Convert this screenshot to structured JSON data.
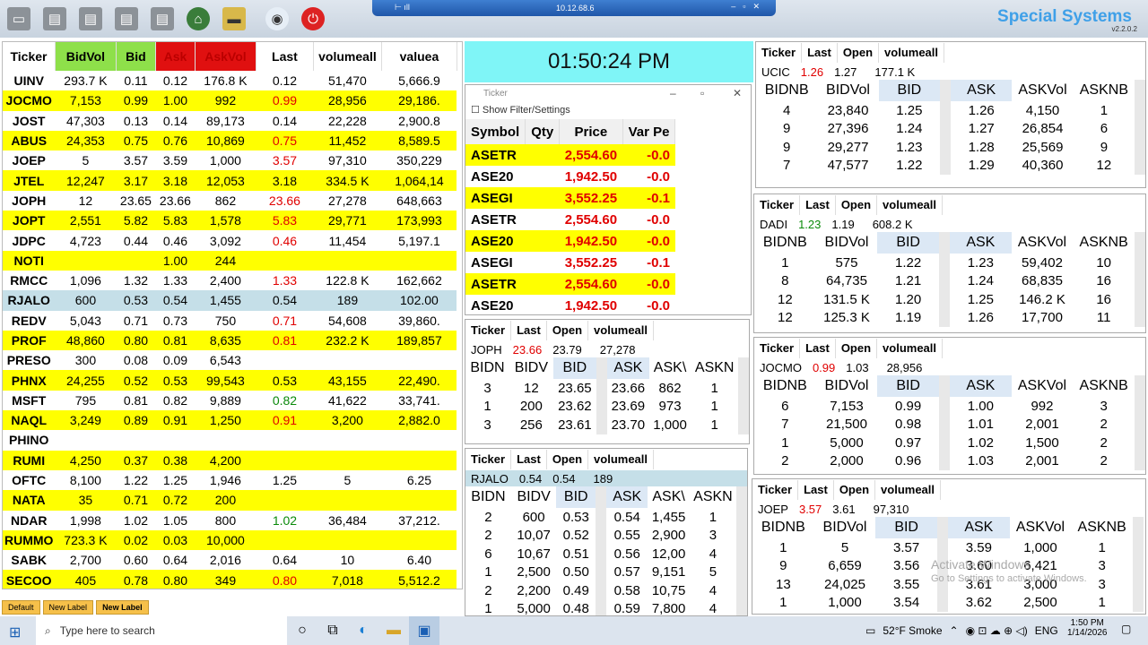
{
  "remote": {
    "host": "10.12.68.6"
  },
  "brand": {
    "name": "Special Systems",
    "version": "v2.2.0.2"
  },
  "clock": "01:50:24 PM",
  "main_table": {
    "headers": [
      "Ticker",
      "BidVol",
      "Bid",
      "Ask",
      "AskVol",
      "Last",
      "volumeall",
      "valuea"
    ],
    "rows": [
      {
        "style": "wr",
        "c": [
          "UINV",
          "293.7 K",
          "0.11",
          "0.12",
          "176.8 K",
          "0.12",
          "51,470",
          "5,666.9"
        ],
        "last": ""
      },
      {
        "style": "yr",
        "c": [
          "JOCMO",
          "7,153",
          "0.99",
          "1.00",
          "992",
          "0.99",
          "28,956",
          "29,186."
        ],
        "last": "red"
      },
      {
        "style": "wr",
        "c": [
          "JOST",
          "47,303",
          "0.13",
          "0.14",
          "89,173",
          "0.14",
          "22,228",
          "2,900.8"
        ],
        "last": ""
      },
      {
        "style": "yr",
        "c": [
          "ABUS",
          "24,353",
          "0.75",
          "0.76",
          "10,869",
          "0.75",
          "11,452",
          "8,589.5"
        ],
        "last": "red"
      },
      {
        "style": "wr",
        "c": [
          "JOEP",
          "5",
          "3.57",
          "3.59",
          "1,000",
          "3.57",
          "97,310",
          "350,229"
        ],
        "last": "red"
      },
      {
        "style": "yr",
        "c": [
          "JTEL",
          "12,247",
          "3.17",
          "3.18",
          "12,053",
          "3.18",
          "334.5 K",
          "1,064,14"
        ],
        "last": ""
      },
      {
        "style": "wr",
        "c": [
          "JOPH",
          "12",
          "23.65",
          "23.66",
          "862",
          "23.66",
          "27,278",
          "648,663"
        ],
        "last": "red"
      },
      {
        "style": "yr",
        "c": [
          "JOPT",
          "2,551",
          "5.82",
          "5.83",
          "1,578",
          "5.83",
          "29,771",
          "173,993"
        ],
        "last": "red"
      },
      {
        "style": "wr",
        "c": [
          "JDPC",
          "4,723",
          "0.44",
          "0.46",
          "3,092",
          "0.46",
          "11,454",
          "5,197.1"
        ],
        "last": "red"
      },
      {
        "style": "yr",
        "c": [
          "NOTI",
          "",
          "",
          "1.00",
          "244",
          "",
          "",
          ""
        ],
        "last": ""
      },
      {
        "style": "wr",
        "c": [
          "RMCC",
          "1,096",
          "1.32",
          "1.33",
          "2,400",
          "1.33",
          "122.8 K",
          "162,662"
        ],
        "last": "red"
      },
      {
        "style": "br",
        "c": [
          "RJALO",
          "600",
          "0.53",
          "0.54",
          "1,455",
          "0.54",
          "189",
          "102.00"
        ],
        "last": ""
      },
      {
        "style": "wr",
        "c": [
          "REDV",
          "5,043",
          "0.71",
          "0.73",
          "750",
          "0.71",
          "54,608",
          "39,860."
        ],
        "last": "red"
      },
      {
        "style": "yr",
        "c": [
          "PROF",
          "48,860",
          "0.80",
          "0.81",
          "8,635",
          "0.81",
          "232.2 K",
          "189,857"
        ],
        "last": "red"
      },
      {
        "style": "wr",
        "c": [
          "PRESO",
          "300",
          "0.08",
          "0.09",
          "6,543",
          "",
          "",
          ""
        ],
        "last": ""
      },
      {
        "style": "yr",
        "c": [
          "PHNX",
          "24,255",
          "0.52",
          "0.53",
          "99,543",
          "0.53",
          "43,155",
          "22,490."
        ],
        "last": ""
      },
      {
        "style": "wr",
        "c": [
          "MSFT",
          "795",
          "0.81",
          "0.82",
          "9,889",
          "0.82",
          "41,622",
          "33,741."
        ],
        "last": "grn"
      },
      {
        "style": "yr",
        "c": [
          "NAQL",
          "3,249",
          "0.89",
          "0.91",
          "1,250",
          "0.91",
          "3,200",
          "2,882.0"
        ],
        "last": "red"
      },
      {
        "style": "wr",
        "c": [
          "PHINO",
          "",
          "",
          "",
          "",
          "",
          "",
          ""
        ],
        "last": ""
      },
      {
        "style": "yr",
        "c": [
          "RUMI",
          "4,250",
          "0.37",
          "0.38",
          "4,200",
          "",
          "",
          ""
        ],
        "last": ""
      },
      {
        "style": "wr",
        "c": [
          "OFTC",
          "8,100",
          "1.22",
          "1.25",
          "1,946",
          "1.25",
          "5",
          "6.25"
        ],
        "last": ""
      },
      {
        "style": "yr",
        "c": [
          "NATA",
          "35",
          "0.71",
          "0.72",
          "200",
          "",
          "",
          ""
        ],
        "last": ""
      },
      {
        "style": "wr",
        "c": [
          "NDAR",
          "1,998",
          "1.02",
          "1.05",
          "800",
          "1.02",
          "36,484",
          "37,212."
        ],
        "last": "grn"
      },
      {
        "style": "yr",
        "c": [
          "RUMMO",
          "723.3 K",
          "0.02",
          "0.03",
          "10,000",
          "",
          "",
          ""
        ],
        "last": ""
      },
      {
        "style": "wr",
        "c": [
          "SABK",
          "2,700",
          "0.60",
          "0.64",
          "2,016",
          "0.64",
          "10",
          "6.40"
        ],
        "last": ""
      },
      {
        "style": "yr",
        "c": [
          "SECOO",
          "405",
          "0.78",
          "0.80",
          "349",
          "0.80",
          "7,018",
          "5,512.2"
        ],
        "last": "red"
      }
    ]
  },
  "labels": [
    "Default",
    "New Label",
    "New Label"
  ],
  "ticker_window": {
    "title": "Ticker",
    "filter_label": "Show Filter/Settings",
    "headers": [
      "Symbol",
      "Qty",
      "Price",
      "Var Pe"
    ],
    "rows": [
      {
        "style": "yr",
        "c": [
          "ASETR",
          "",
          "2,554.60",
          "-0.0"
        ]
      },
      {
        "style": "wr",
        "c": [
          "ASE20",
          "",
          "1,942.50",
          "-0.0"
        ]
      },
      {
        "style": "yr",
        "c": [
          "ASEGI",
          "",
          "3,552.25",
          "-0.1"
        ]
      },
      {
        "style": "wr",
        "c": [
          "ASETR",
          "",
          "2,554.60",
          "-0.0"
        ]
      },
      {
        "style": "yr",
        "c": [
          "ASE20",
          "",
          "1,942.50",
          "-0.0"
        ]
      },
      {
        "style": "wr",
        "c": [
          "ASEGI",
          "",
          "3,552.25",
          "-0.1"
        ]
      },
      {
        "style": "yr",
        "c": [
          "ASETR",
          "",
          "2,554.60",
          "-0.0"
        ]
      },
      {
        "style": "wr",
        "c": [
          "ASE20",
          "",
          "1,942.50",
          "-0.0"
        ]
      }
    ]
  },
  "quote_head": [
    "Ticker",
    "Last",
    "Open",
    "volumeall"
  ],
  "depth_head_left": [
    "BIDNB",
    "BIDVol",
    "BID"
  ],
  "depth_head_right": [
    "ASK",
    "ASKVol",
    "ASKNB"
  ],
  "depth_head_left_s": [
    "BIDN",
    "BIDV",
    "BID"
  ],
  "depth_head_right_s": [
    "ASK",
    "ASK\\",
    "ASKN"
  ],
  "books": [
    {
      "ticker": "UCIC",
      "last": "1.26",
      "open": "1.27",
      "vol": "177.1 K",
      "last_color": "red",
      "bids": [
        [
          "4",
          "23,840",
          "1.25"
        ],
        [
          "9",
          "27,396",
          "1.24"
        ],
        [
          "9",
          "29,277",
          "1.23"
        ],
        [
          "7",
          "47,577",
          "1.22"
        ]
      ],
      "asks": [
        [
          "1.26",
          "4,150",
          "1"
        ],
        [
          "1.27",
          "26,854",
          "6"
        ],
        [
          "1.28",
          "25,569",
          "9"
        ],
        [
          "1.29",
          "40,360",
          "12"
        ]
      ]
    },
    {
      "ticker": "DADI",
      "last": "1.23",
      "open": "1.19",
      "vol": "608.2 K",
      "last_color": "grn",
      "bids": [
        [
          "1",
          "575",
          "1.22"
        ],
        [
          "8",
          "64,735",
          "1.21"
        ],
        [
          "12",
          "131.5 K",
          "1.20"
        ],
        [
          "12",
          "125.3 K",
          "1.19"
        ]
      ],
      "asks": [
        [
          "1.23",
          "59,402",
          "10"
        ],
        [
          "1.24",
          "68,835",
          "16"
        ],
        [
          "1.25",
          "146.2 K",
          "16"
        ],
        [
          "1.26",
          "17,700",
          "11"
        ]
      ]
    },
    {
      "ticker": "JOCMO",
      "last": "0.99",
      "open": "1.03",
      "vol": "28,956",
      "last_color": "red",
      "bids": [
        [
          "6",
          "7,153",
          "0.99"
        ],
        [
          "7",
          "21,500",
          "0.98"
        ],
        [
          "1",
          "5,000",
          "0.97"
        ],
        [
          "2",
          "2,000",
          "0.96"
        ]
      ],
      "asks": [
        [
          "1.00",
          "992",
          "3"
        ],
        [
          "1.01",
          "2,001",
          "2"
        ],
        [
          "1.02",
          "1,500",
          "2"
        ],
        [
          "1.03",
          "2,001",
          "2"
        ]
      ]
    },
    {
      "ticker": "JOEP",
      "last": "3.57",
      "open": "3.61",
      "vol": "97,310",
      "last_color": "red",
      "bids": [
        [
          "1",
          "5",
          "3.57"
        ],
        [
          "9",
          "6,659",
          "3.56"
        ],
        [
          "13",
          "24,025",
          "3.55"
        ],
        [
          "1",
          "1,000",
          "3.54"
        ]
      ],
      "asks": [
        [
          "3.59",
          "1,000",
          "1"
        ],
        [
          "3.60",
          "6,421",
          "3"
        ],
        [
          "3.61",
          "3,000",
          "3"
        ],
        [
          "3.62",
          "2,500",
          "1"
        ]
      ]
    },
    {
      "ticker": "JOPH",
      "last": "23.66",
      "open": "23.79",
      "vol": "27,278",
      "last_color": "red",
      "bids": [
        [
          "3",
          "12",
          "23.65"
        ],
        [
          "1",
          "200",
          "23.62"
        ],
        [
          "3",
          "256",
          "23.61"
        ]
      ],
      "asks": [
        [
          "23.66",
          "862",
          "1"
        ],
        [
          "23.69",
          "973",
          "1"
        ],
        [
          "23.70",
          "1,000",
          "1"
        ]
      ]
    },
    {
      "ticker": "RJALO",
      "last": "0.54",
      "open": "0.54",
      "vol": "189",
      "last_color": "",
      "bids": [
        [
          "2",
          "600",
          "0.53"
        ],
        [
          "2",
          "10,07",
          "0.52"
        ],
        [
          "6",
          "10,67",
          "0.51"
        ],
        [
          "1",
          "2,500",
          "0.50"
        ],
        [
          "2",
          "2,200",
          "0.49"
        ],
        [
          "1",
          "5,000",
          "0.48"
        ]
      ],
      "asks": [
        [
          "0.54",
          "1,455",
          "1"
        ],
        [
          "0.55",
          "2,900",
          "3"
        ],
        [
          "0.56",
          "12,00",
          "4"
        ],
        [
          "0.57",
          "9,151",
          "5"
        ],
        [
          "0.58",
          "10,75",
          "4"
        ],
        [
          "0.59",
          "7,800",
          "4"
        ]
      ]
    }
  ],
  "watermark": {
    "line1": "Activate Windows",
    "line2": "Go to Settings to activate Windows."
  },
  "taskbar": {
    "search_placeholder": "Type here to search",
    "weather": "52°F Smoke",
    "lang": "ENG",
    "time": "1:50 PM",
    "date": "1/14/2026"
  }
}
